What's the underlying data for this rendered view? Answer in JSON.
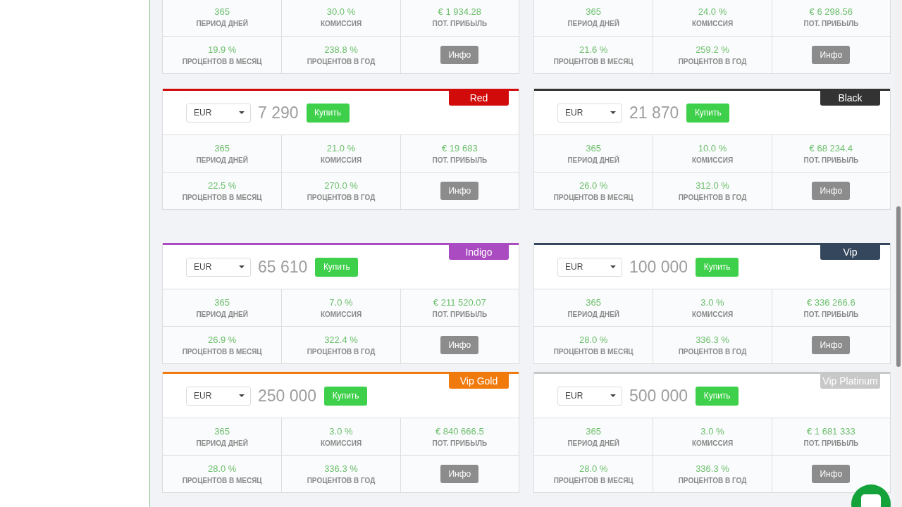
{
  "plans": [
    {
      "kind": "partial",
      "stats": [
        {
          "value": "365",
          "label": "ПЕРИОД ДНЕЙ"
        },
        {
          "value": "30.0 %",
          "label": "КОМИССИЯ"
        },
        {
          "value": "€ 1 934.28",
          "label": "ПОТ. ПРИБЫЛЬ"
        },
        {
          "value": "19.9 %",
          "label": "ПРОЦЕНТОВ В МЕСЯЦ"
        },
        {
          "value": "238.8 %",
          "label": "ПРОЦЕНТОВ В ГОД"
        }
      ],
      "info_button": "Инфо"
    },
    {
      "kind": "partial",
      "stats": [
        {
          "value": "365",
          "label": "ПЕРИОД ДНЕЙ"
        },
        {
          "value": "24.0 %",
          "label": "КОМИССИЯ"
        },
        {
          "value": "€ 6 298.56",
          "label": "ПОТ. ПРИБЫЛЬ"
        },
        {
          "value": "21.6 %",
          "label": "ПРОЦЕНТОВ В МЕСЯЦ"
        },
        {
          "value": "259.2 %",
          "label": "ПРОЦЕНТОВ В ГОД"
        }
      ],
      "info_button": "Инфо"
    },
    {
      "kind": "full",
      "badge": "Red",
      "color": "#d10a0a",
      "currency": "EUR",
      "amount": "7 290",
      "buy_button": "Купить",
      "stats": [
        {
          "value": "365",
          "label": "ПЕРИОД ДНЕЙ"
        },
        {
          "value": "21.0 %",
          "label": "КОМИССИЯ"
        },
        {
          "value": "€ 19 683",
          "label": "ПОТ. ПРИБЫЛЬ"
        },
        {
          "value": "22.5 %",
          "label": "ПРОЦЕНТОВ В МЕСЯЦ"
        },
        {
          "value": "270.0 %",
          "label": "ПРОЦЕНТОВ В ГОД"
        }
      ],
      "info_button": "Инфо"
    },
    {
      "kind": "full",
      "badge": "Black",
      "color": "#333333",
      "currency": "EUR",
      "amount": "21 870",
      "buy_button": "Купить",
      "stats": [
        {
          "value": "365",
          "label": "ПЕРИОД ДНЕЙ"
        },
        {
          "value": "10.0 %",
          "label": "КОМИССИЯ"
        },
        {
          "value": "€ 68 234.4",
          "label": "ПОТ. ПРИБЫЛЬ"
        },
        {
          "value": "26.0 %",
          "label": "ПРОЦЕНТОВ В МЕСЯЦ"
        },
        {
          "value": "312.0 %",
          "label": "ПРОЦЕНТОВ В ГОД"
        }
      ],
      "info_button": "Инфо"
    },
    {
      "kind": "full",
      "badge": "Indigo",
      "color": "#ab4bc2",
      "currency": "EUR",
      "amount": "65 610",
      "buy_button": "Купить",
      "stats": [
        {
          "value": "365",
          "label": "ПЕРИОД ДНЕЙ"
        },
        {
          "value": "7.0 %",
          "label": "КОМИССИЯ"
        },
        {
          "value": "€ 211 520.07",
          "label": "ПОТ. ПРИБЫЛЬ"
        },
        {
          "value": "26.9 %",
          "label": "ПРОЦЕНТОВ В МЕСЯЦ"
        },
        {
          "value": "322.4 %",
          "label": "ПРОЦЕНТОВ В ГОД"
        }
      ],
      "info_button": "Инфо"
    },
    {
      "kind": "full",
      "badge": "Vip",
      "color": "#34475c",
      "currency": "EUR",
      "amount": "100 000",
      "buy_button": "Купить",
      "stats": [
        {
          "value": "365",
          "label": "ПЕРИОД ДНЕЙ"
        },
        {
          "value": "3.0 %",
          "label": "КОМИССИЯ"
        },
        {
          "value": "€ 336 266.6",
          "label": "ПОТ. ПРИБЫЛЬ"
        },
        {
          "value": "28.0 %",
          "label": "ПРОЦЕНТОВ В МЕСЯЦ"
        },
        {
          "value": "336.3 %",
          "label": "ПРОЦЕНТОВ В ГОД"
        }
      ],
      "info_button": "Инфо"
    },
    {
      "kind": "full",
      "badge": "Vip Gold",
      "color": "#f07a0c",
      "currency": "EUR",
      "amount": "250 000",
      "buy_button": "Купить",
      "stats": [
        {
          "value": "365",
          "label": "ПЕРИОД ДНЕЙ"
        },
        {
          "value": "3.0 %",
          "label": "КОМИССИЯ"
        },
        {
          "value": "€ 840 666.5",
          "label": "ПОТ. ПРИБЫЛЬ"
        },
        {
          "value": "28.0 %",
          "label": "ПРОЦЕНТОВ В МЕСЯЦ"
        },
        {
          "value": "336.3 %",
          "label": "ПРОЦЕНТОВ В ГОД"
        }
      ],
      "info_button": "Инфо"
    },
    {
      "kind": "full",
      "badge": "Vip Platinum",
      "color": "#c8c8c8",
      "currency": "EUR",
      "amount": "500 000",
      "buy_button": "Купить",
      "stats": [
        {
          "value": "365",
          "label": "ПЕРИОД ДНЕЙ"
        },
        {
          "value": "3.0 %",
          "label": "КОМИССИЯ"
        },
        {
          "value": "€ 1 681 333",
          "label": "ПОТ. ПРИБЫЛЬ"
        },
        {
          "value": "28.0 %",
          "label": "ПРОЦЕНТОВ В МЕСЯЦ"
        },
        {
          "value": "336.3 %",
          "label": "ПРОЦЕНТОВ В ГОД"
        }
      ],
      "info_button": "Инфо"
    }
  ]
}
